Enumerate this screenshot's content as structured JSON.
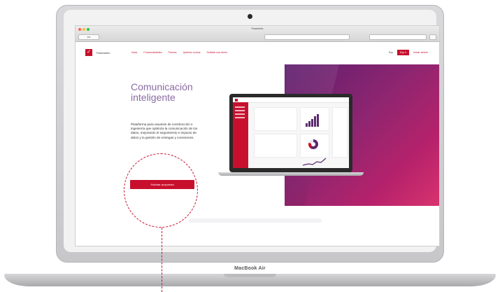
{
  "device": {
    "brand_label": "MacBook Air"
  },
  "browser": {
    "tab_title": "Parametric",
    "nav_label": "◂ ▸"
  },
  "site": {
    "logo_text": "Parametric",
    "nav": [
      "Inicio",
      "Funcionalidades",
      "Precios",
      "Quiénes somos",
      "Solicitar una demo"
    ],
    "lang": "Esp",
    "lang_button": "Esp ▾",
    "login": "Iniciar sesión"
  },
  "hero": {
    "title": "Comunicación inteligente",
    "description": "Plataforma para usuarios de construcción e ingeniería que optimiza la comunicación de los datos, mejorando el seguimiento e impacto de datos y la gestión de entregas y conexiones.",
    "cta_label": "Solicitar propuesta"
  },
  "colors": {
    "brand": "#c8102e",
    "title": "#8a6aa3",
    "hero_gradient_start": "#5e1f6e",
    "hero_gradient_end": "#d9336f"
  }
}
